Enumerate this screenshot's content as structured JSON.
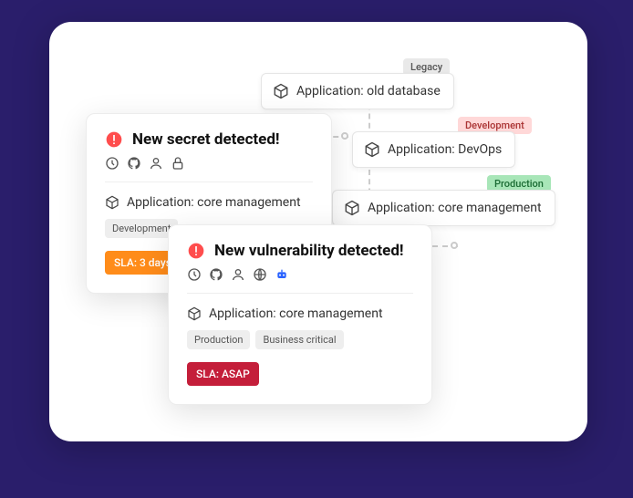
{
  "apps": {
    "old_db": {
      "label": "Application: old database",
      "badge": "Legacy"
    },
    "devops": {
      "label": "Application: DevOps",
      "badge": "Development"
    },
    "core_prod": {
      "label": "Application: core management",
      "badge": "Production"
    }
  },
  "alert1": {
    "title": "New secret detected!",
    "app": "Application: core management",
    "tags": [
      "Development"
    ],
    "sla": "SLA: 3 days"
  },
  "alert2": {
    "title": "New vulnerability detected!",
    "app": "Application: core management",
    "tags": [
      "Production",
      "Business critical"
    ],
    "sla": "SLA: ASAP"
  }
}
